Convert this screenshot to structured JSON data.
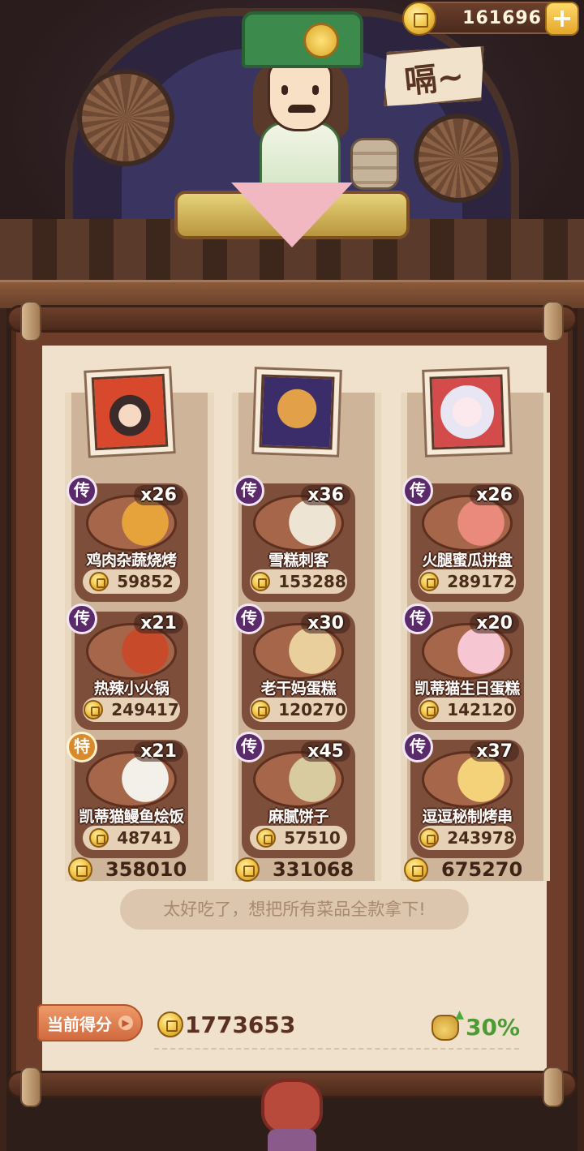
{
  "header": {
    "coin_balance": "161696",
    "plus_label": "+",
    "sign_text": "嗝~"
  },
  "columns": [
    {
      "dishes": [
        {
          "rank": "传",
          "qty": "x26",
          "name": "鸡肉杂蔬烧烤",
          "price": "59852",
          "food_color": "#e6a23b"
        },
        {
          "rank": "传",
          "qty": "x21",
          "name": "热辣小火锅",
          "price": "249417",
          "food_color": "#c74b2b"
        },
        {
          "rank": "特",
          "qty": "x21",
          "name": "凯蒂猫鳗鱼烩饭",
          "price": "48741",
          "food_color": "#f3f0ea"
        }
      ],
      "total": "358010"
    },
    {
      "dishes": [
        {
          "rank": "传",
          "qty": "x36",
          "name": "雪糕刺客",
          "price": "153288",
          "food_color": "#eee4d4"
        },
        {
          "rank": "传",
          "qty": "x30",
          "name": "老干妈蛋糕",
          "price": "120270",
          "food_color": "#e8cf9c"
        },
        {
          "rank": "传",
          "qty": "x45",
          "name": "麻腻饼子",
          "price": "57510",
          "food_color": "#d9cba0"
        }
      ],
      "total": "331068"
    },
    {
      "dishes": [
        {
          "rank": "传",
          "qty": "x26",
          "name": "火腿蜜瓜拼盘",
          "price": "289172",
          "food_color": "#e98a7c"
        },
        {
          "rank": "传",
          "qty": "x20",
          "name": "凯蒂猫生日蛋糕",
          "price": "142120",
          "food_color": "#f6c6d2"
        },
        {
          "rank": "传",
          "qty": "x37",
          "name": "逗逗秘制烤串",
          "price": "243978",
          "food_color": "#f3d27a"
        }
      ],
      "total": "675270"
    }
  ],
  "comment": "太好吃了，想把所有菜品全款拿下!",
  "score": {
    "label": "当前得分",
    "arrow": "▶",
    "value": "1773653",
    "bonus": "30%"
  },
  "colors": {
    "panel_bg": "#efe1cc",
    "dish_card": "#7d4e3a",
    "rank_legend": "#5b2a6b",
    "rank_special": "#d98a2d",
    "bonus_green": "#4e9a34"
  }
}
